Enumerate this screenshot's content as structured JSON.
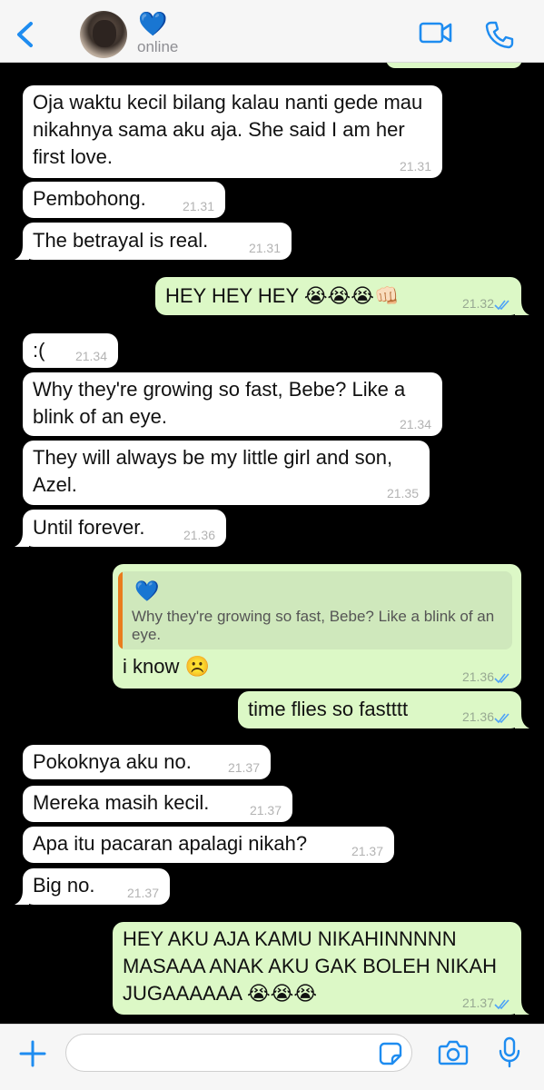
{
  "header": {
    "back_icon": "chevron-left-icon",
    "contact_name": "💙",
    "status": "online",
    "video_icon": "video-call-icon",
    "phone_icon": "phone-call-icon",
    "accent": "#1e8cf0"
  },
  "messages": [
    {
      "dir": "in",
      "text": "Oja waktu kecil bilang kalau nanti gede mau nikahnya sama aku aja. She said I am her first love.",
      "time": "21.31"
    },
    {
      "dir": "in",
      "text": "Pembohong.",
      "time": "21.31"
    },
    {
      "dir": "in",
      "text": "The betrayal is real.",
      "time": "21.31"
    },
    {
      "dir": "out",
      "text": "HEY HEY HEY 😭😭😭👊🏻",
      "time": "21.32"
    },
    {
      "dir": "in",
      "text": ":(",
      "time": "21.34"
    },
    {
      "dir": "in",
      "text": "Why they're growing so fast, Bebe? Like a blink of an eye.",
      "time": "21.34"
    },
    {
      "dir": "in",
      "text": "They will always be my little girl and son, Azel.",
      "time": "21.35"
    },
    {
      "dir": "in",
      "text": "Until forever.",
      "time": "21.36"
    },
    {
      "dir": "out",
      "quote_name": "💙",
      "quote_text": "Why they're growing so fast, Bebe? Like a blink of an eye.",
      "text": "i know ☹️",
      "time": "21.36"
    },
    {
      "dir": "out",
      "text": "time flies so fastttt",
      "time": "21.36"
    },
    {
      "dir": "in",
      "text": "Pokoknya aku no.",
      "time": "21.37"
    },
    {
      "dir": "in",
      "text": "Mereka masih kecil.",
      "time": "21.37"
    },
    {
      "dir": "in",
      "text": "Apa itu pacaran apalagi nikah?",
      "time": "21.37"
    },
    {
      "dir": "in",
      "text": "Big no.",
      "time": "21.37"
    },
    {
      "dir": "out",
      "text": "HEY AKU AJA KAMU NIKAHINNNNN MASAAA ANAK AKU GAK BOLEH NIKAH JUGAAAAAA 😭😭😭",
      "time": "21.37"
    }
  ],
  "footer": {
    "add_icon": "plus-icon",
    "sticker_icon": "sticker-icon",
    "camera_icon": "camera-icon",
    "mic_icon": "microphone-icon",
    "input_value": ""
  },
  "colors": {
    "incoming_bubble": "#ffffff",
    "outgoing_bubble": "#dcf8c6",
    "read_ticks": "#4fa3f7",
    "chat_background": "#000000"
  }
}
